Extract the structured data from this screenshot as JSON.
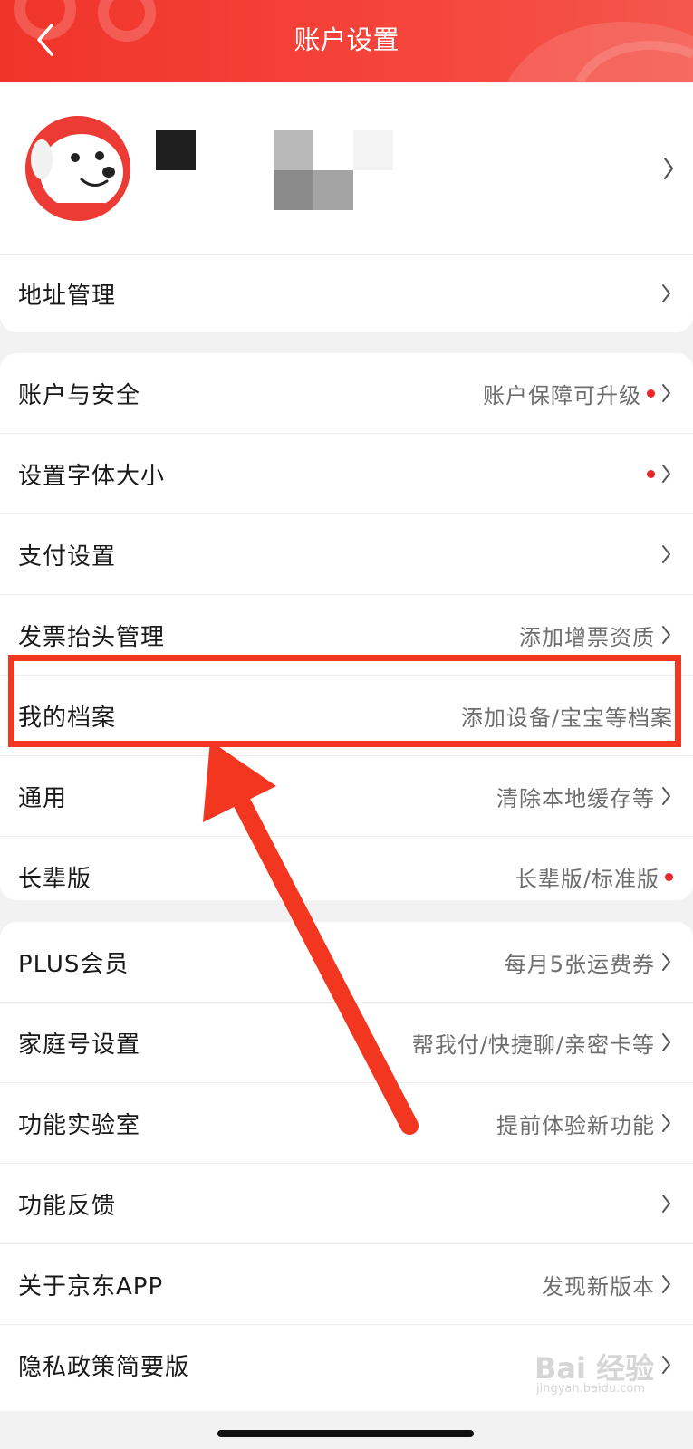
{
  "header": {
    "title": "账户设置",
    "back_icon": "chevron-left-icon"
  },
  "profile": {
    "avatar": "jd-mascot-avatar",
    "chevron_icon": "chevron-right-icon"
  },
  "address_section": {
    "items": [
      {
        "label": "地址管理",
        "hint": "",
        "dot": false
      }
    ]
  },
  "settings_section": {
    "items": [
      {
        "label": "账户与安全",
        "hint": "账户保障可升级",
        "dot": true,
        "chevron": true
      },
      {
        "label": "设置字体大小",
        "hint": "",
        "dot": true,
        "chevron": true
      },
      {
        "label": "支付设置",
        "hint": "",
        "dot": false,
        "chevron": true
      },
      {
        "label": "发票抬头管理",
        "hint": "添加增票资质",
        "dot": false,
        "chevron": true
      },
      {
        "label": "我的档案",
        "hint": "添加设备/宝宝等档案",
        "dot": false,
        "chevron": false
      },
      {
        "label": "通用",
        "hint": "清除本地缓存等",
        "dot": false,
        "chevron": true
      },
      {
        "label": "长辈版",
        "hint": "长辈版/标准版",
        "dot": true,
        "chevron": false
      }
    ]
  },
  "more_section": {
    "items": [
      {
        "label": "PLUS会员",
        "hint": "每月5张运费券"
      },
      {
        "label": "家庭号设置",
        "hint": "帮我付/快捷聊/亲密卡等"
      },
      {
        "label": "功能实验室",
        "hint": "提前体验新功能"
      },
      {
        "label": "功能反馈",
        "hint": ""
      },
      {
        "label": "关于京东APP",
        "hint": "发现新版本"
      },
      {
        "label": "隐私政策简要版",
        "hint": ""
      }
    ]
  },
  "watermark": {
    "brand": "Bai 经验",
    "url": "jingyan.baidu.com"
  },
  "colors": {
    "brand_red": "#f0342a",
    "highlight_red": "#f2361f",
    "dot_red": "#e8262a"
  }
}
